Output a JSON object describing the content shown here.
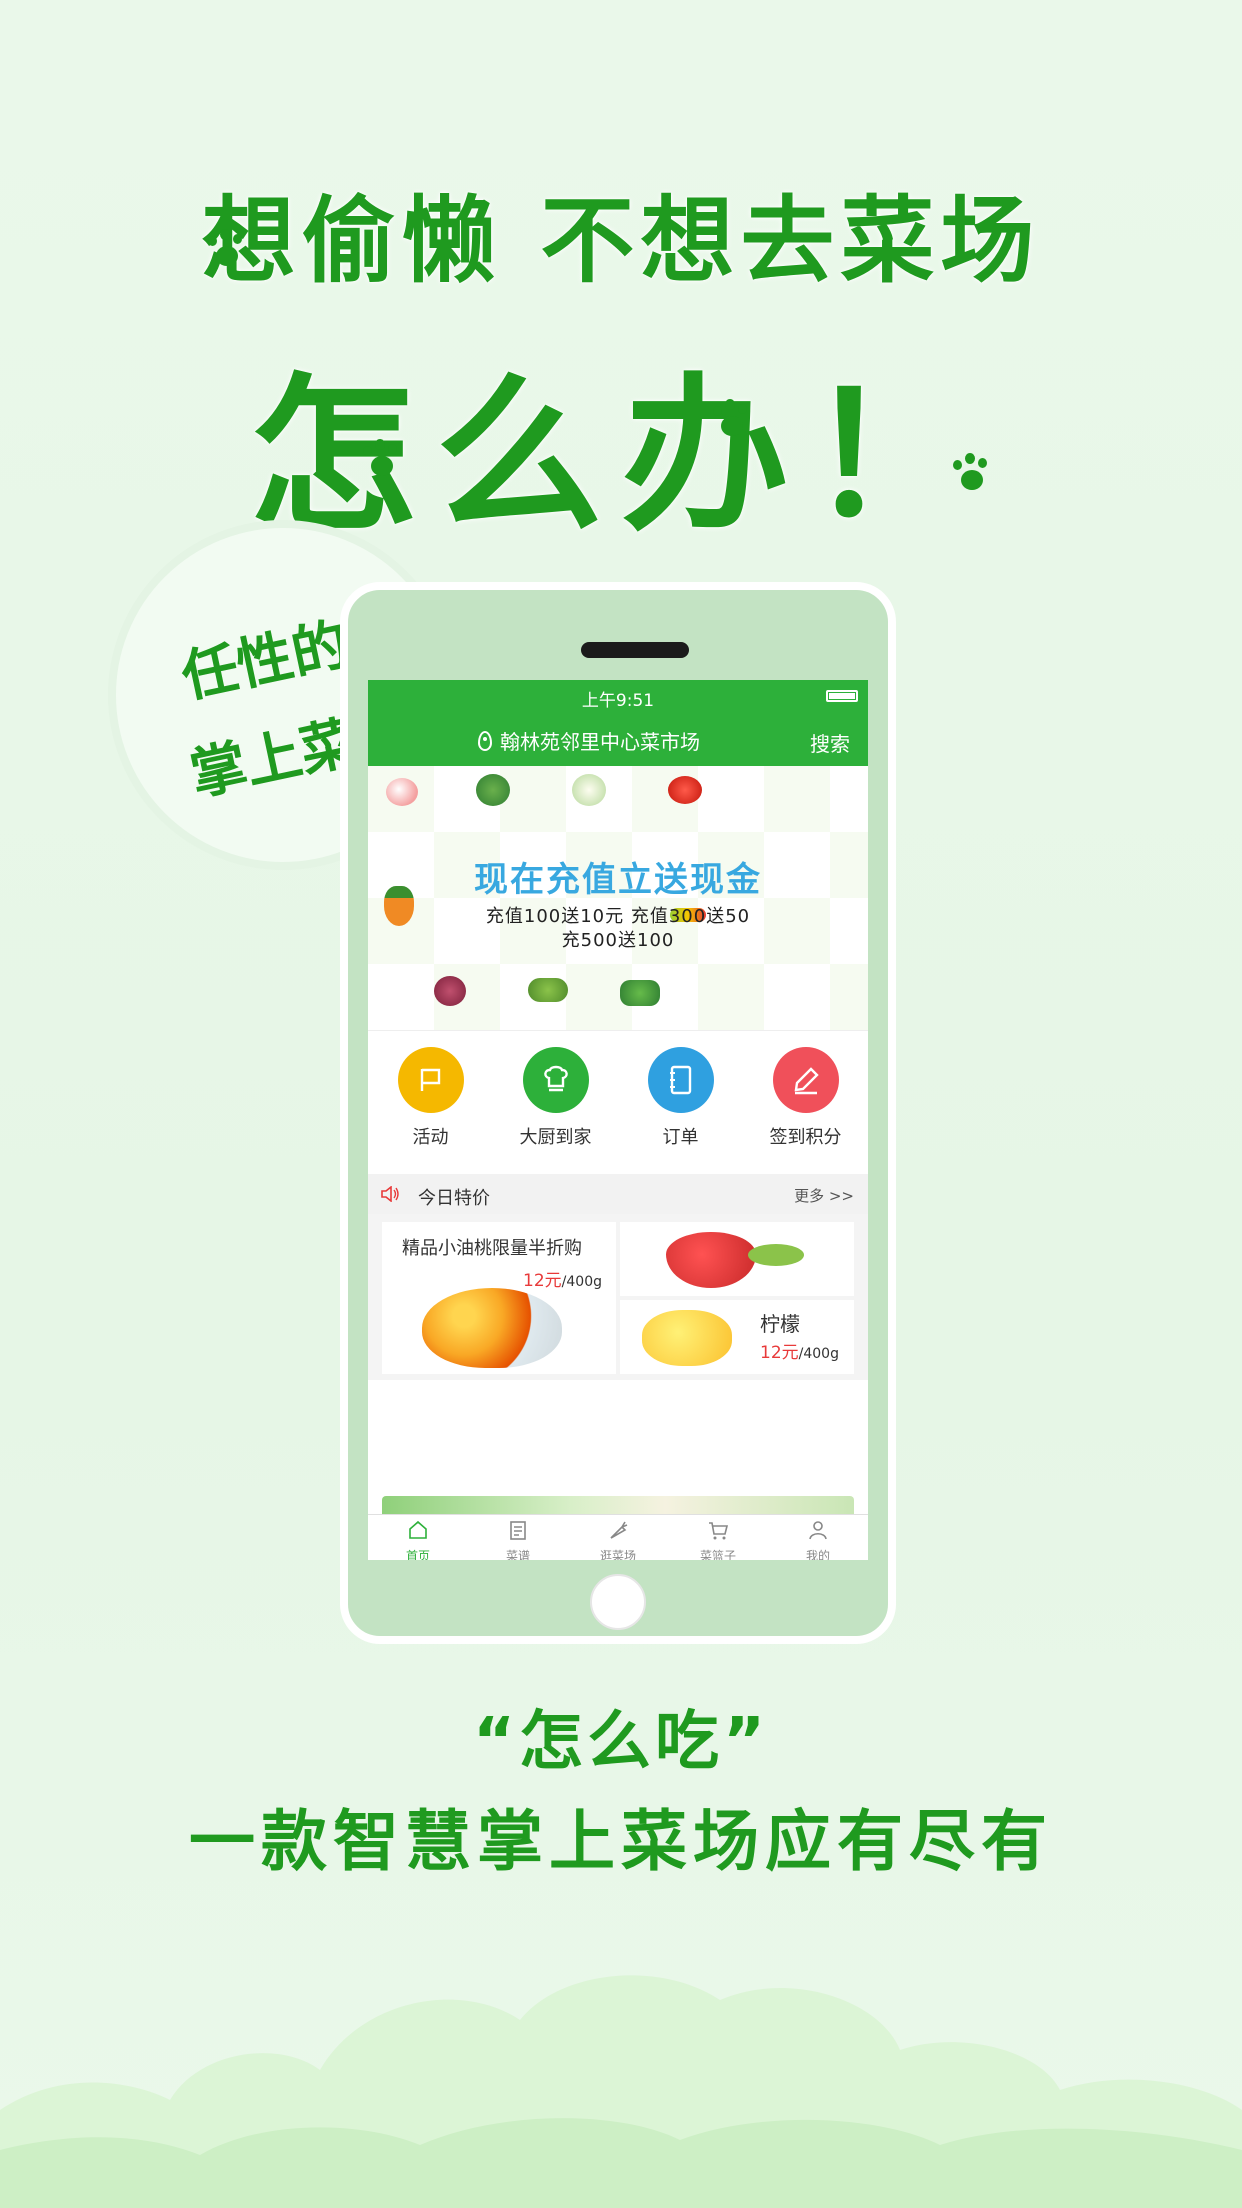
{
  "headline": {
    "line1": "想偷懒 不想去菜场",
    "line2": "怎么办！"
  },
  "badge": {
    "line1": "任性的",
    "line2": "掌上菜场"
  },
  "app": {
    "status_time": "上午9:51",
    "location": "翰林苑邻里中心菜市场",
    "search_label": "搜索",
    "banner": {
      "title": "现在充值立送现金",
      "line1": "充值100送10元  充值300送50",
      "line2": "充500送100"
    },
    "categories": [
      {
        "label": "活动",
        "color": "#f5b800",
        "icon": "flag-icon"
      },
      {
        "label": "大厨到家",
        "color": "#2db03a",
        "icon": "chef-hat-icon"
      },
      {
        "label": "订单",
        "color": "#2fa0e0",
        "icon": "notebook-icon"
      },
      {
        "label": "签到积分",
        "color": "#f0505a",
        "icon": "pen-icon"
      }
    ],
    "special": {
      "title": "今日特价",
      "more": "更多 >>"
    },
    "deals": {
      "main_title": "精品小油桃限量半折购",
      "main_price": "12元",
      "main_unit": "/400g",
      "lemon_name": "柠檬",
      "lemon_price": "12元",
      "lemon_unit": "/400g"
    },
    "tabs": [
      {
        "label": "首页",
        "icon": "home-icon",
        "active": true
      },
      {
        "label": "菜谱",
        "icon": "recipe-icon",
        "active": false
      },
      {
        "label": "逛菜场",
        "icon": "carrot-icon",
        "active": false
      },
      {
        "label": "菜篮子",
        "icon": "cart-icon",
        "active": false
      },
      {
        "label": "我的",
        "icon": "user-icon",
        "active": false
      }
    ]
  },
  "tagline": {
    "line1": "“怎么吃”",
    "line2": "一款智慧掌上菜场应有尽有"
  },
  "colors": {
    "brand_green": "#2db03a",
    "headline_green": "#1f9a1f",
    "price_red": "#e83a3a"
  }
}
